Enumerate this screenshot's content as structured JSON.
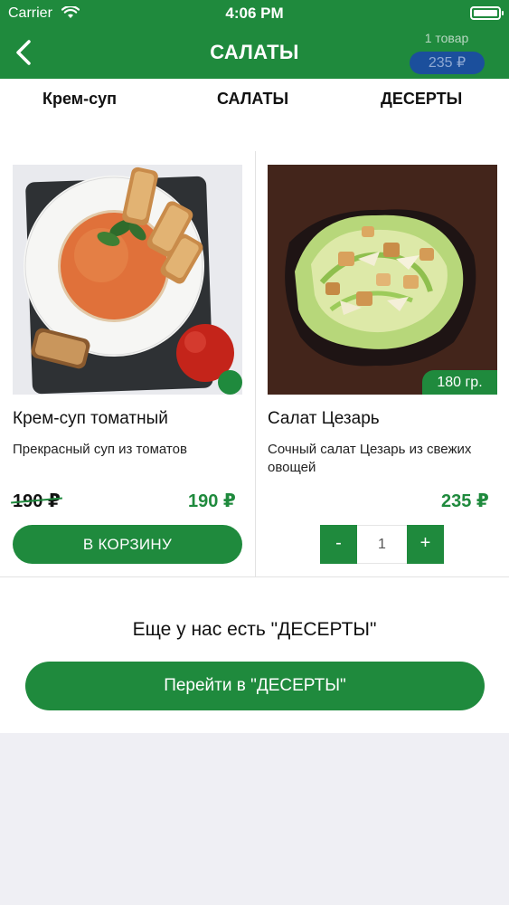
{
  "status_bar": {
    "carrier": "Carrier",
    "time": "4:06 PM",
    "icons": [
      "wifi-icon",
      "battery-icon"
    ]
  },
  "nav": {
    "title": "САЛАТЫ",
    "back_icon": "chevron-left-icon",
    "cart_count": "1 товар",
    "cart_total": "235 ₽"
  },
  "tabs": [
    {
      "label": "Крем-суп"
    },
    {
      "label": "САЛАТЫ"
    },
    {
      "label": "ДЕСЕРТЫ"
    }
  ],
  "products": [
    {
      "name": "Крем-суп томатный",
      "description": "Прекрасный суп из томатов",
      "old_price": "190 ₽",
      "price": "190 ₽",
      "button_label": "В КОРЗИНУ"
    },
    {
      "name": "Салат Цезарь",
      "description": "Сочный салат Цезарь из свежих овощей",
      "weight": "180 гр.",
      "price": "235 ₽",
      "stepper": {
        "minus": "-",
        "quantity": "1",
        "plus": "+"
      }
    }
  ],
  "more": {
    "text": "Еще у нас есть \"ДЕСЕРТЫ\"",
    "button_label": "Перейти в \"ДЕСЕРТЫ\""
  },
  "colors": {
    "primary_green": "#1f8a3d",
    "cart_badge_blue": "#1b4f9c",
    "background_gray": "#efeff4"
  }
}
